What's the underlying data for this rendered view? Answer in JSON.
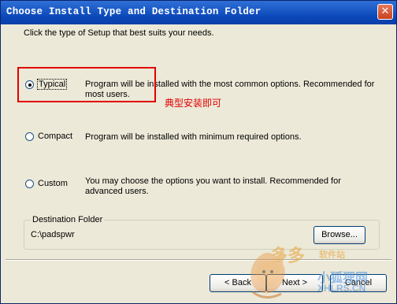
{
  "window": {
    "title": "Choose Install Type and Destination Folder",
    "close_glyph": "✕"
  },
  "intro_text": "Click the type of Setup that best suits your needs.",
  "options": [
    {
      "label": "Typical",
      "selected": true,
      "description": "Program will be installed with the most common options. Recommended for most users."
    },
    {
      "label": "Compact",
      "selected": false,
      "description": "Program will be installed with minimum required options."
    },
    {
      "label": "Custom",
      "selected": false,
      "description": "You may choose the options you want to install. Recommended for advanced users."
    }
  ],
  "annotation": "典型安装即可",
  "destination": {
    "legend": "Destination Folder",
    "path": "C:\\padspwr",
    "browse_label": "Browse..."
  },
  "buttons": {
    "back_label": "< Back",
    "next_label": "Next >",
    "cancel_label": "Cancel"
  },
  "watermark": {
    "chars": "多多",
    "site_label": "软件站",
    "cn_name": "小狐狸网",
    "domain": "XHLRS.CN"
  },
  "colors": {
    "titlebar": "#0B46B8",
    "highlight": "#E00000",
    "face": "#ECE9D8"
  }
}
